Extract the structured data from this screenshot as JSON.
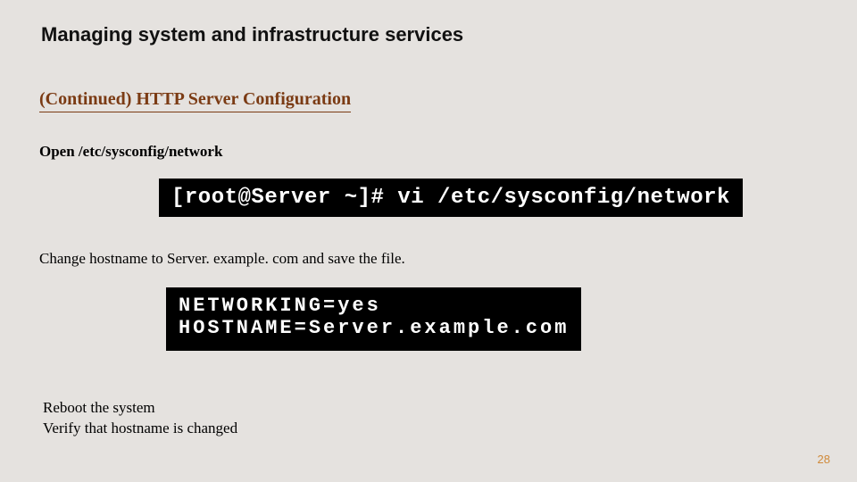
{
  "title": "Managing system and infrastructure services",
  "subhead": "(Continued) HTTP Server Configuration",
  "step1": "Open /etc/sysconfig/network",
  "terminal1": "[root@Server ~]# vi /etc/sysconfig/network",
  "step2": "Change hostname to Server. example. com and save the file.",
  "terminal2": "NETWORKING=yes\nHOSTNAME=Server.example.com",
  "step3": "Reboot the system",
  "step4": "Verify that hostname is changed",
  "page_number": "28"
}
